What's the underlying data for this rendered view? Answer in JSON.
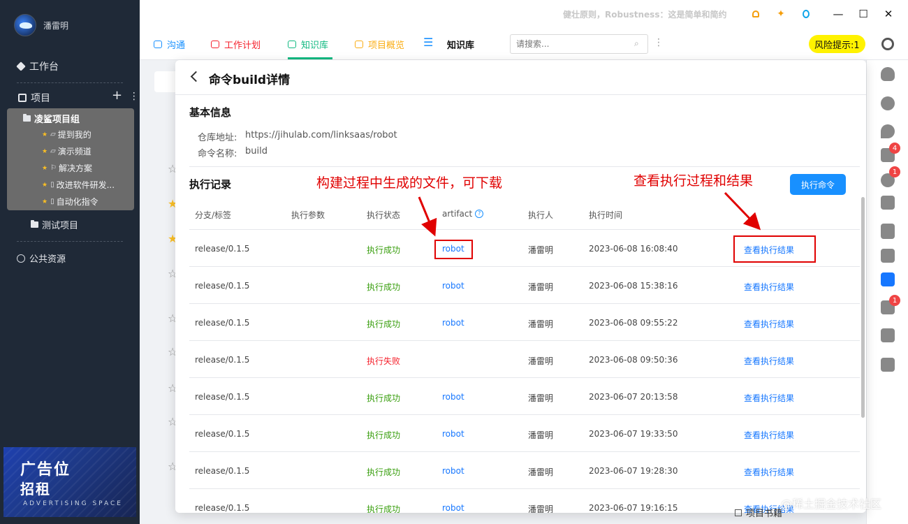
{
  "user": {
    "name": "潘雷明"
  },
  "sidebar": {
    "workbench": "工作台",
    "projects": "项目",
    "add": "+",
    "more": "⋮",
    "group": {
      "title": "凌鲨项目组",
      "items": [
        {
          "icon": "chat-icon",
          "label": "提到我的"
        },
        {
          "icon": "chat-icon",
          "label": "演示频道"
        },
        {
          "icon": "flag-icon",
          "label": "解决方案"
        },
        {
          "icon": "doc-icon",
          "label": "改进软件研发..."
        },
        {
          "icon": "doc-icon",
          "label": "自动化指令"
        }
      ]
    },
    "test_project": "测试项目",
    "public": "公共资源",
    "ad": {
      "line1": "广告位",
      "line2": "招租",
      "line3": "ADVERTISING SPACE"
    }
  },
  "topbar": {
    "tip": "健壮原则，Robustness：这是简单和简约"
  },
  "tabs": {
    "items": [
      {
        "label": "沟通",
        "color": "#1890ff"
      },
      {
        "label": "工作计划",
        "color": "#f5222d"
      },
      {
        "label": "知识库",
        "color": "#10b981"
      },
      {
        "label": "项目概览",
        "color": "#faad14"
      }
    ],
    "current": "知识库",
    "search_placeholder": "请搜索...",
    "risk": "风险提示:1"
  },
  "panel": {
    "title": "命令build详情",
    "basic_title": "基本信息",
    "repo_label": "仓库地址:",
    "repo_value": "https://jihulab.com/linksaas/robot",
    "cmd_label": "命令名称:",
    "cmd_value": "build",
    "exec_title": "执行记录",
    "exec_button": "执行命令",
    "columns": [
      "分支/标签",
      "执行参数",
      "执行状态",
      "artifact",
      "执行人",
      "执行时间"
    ],
    "rows": [
      {
        "branch": "release/0.1.5",
        "params": "",
        "status": "执行成功",
        "artifact": "robot",
        "user": "潘雷明",
        "time": "2023-06-08 16:08:40",
        "action": "查看执行结果"
      },
      {
        "branch": "release/0.1.5",
        "params": "",
        "status": "执行成功",
        "artifact": "robot",
        "user": "潘雷明",
        "time": "2023-06-08 15:38:16",
        "action": "查看执行结果"
      },
      {
        "branch": "release/0.1.5",
        "params": "",
        "status": "执行成功",
        "artifact": "robot",
        "user": "潘雷明",
        "time": "2023-06-08 09:55:22",
        "action": "查看执行结果"
      },
      {
        "branch": "release/0.1.5",
        "params": "",
        "status": "执行失败",
        "artifact": "",
        "user": "潘雷明",
        "time": "2023-06-08 09:50:36",
        "action": "查看执行结果"
      },
      {
        "branch": "release/0.1.5",
        "params": "",
        "status": "执行成功",
        "artifact": "robot",
        "user": "潘雷明",
        "time": "2023-06-07 20:13:58",
        "action": "查看执行结果"
      },
      {
        "branch": "release/0.1.5",
        "params": "",
        "status": "执行成功",
        "artifact": "robot",
        "user": "潘雷明",
        "time": "2023-06-07 19:33:50",
        "action": "查看执行结果"
      },
      {
        "branch": "release/0.1.5",
        "params": "",
        "status": "执行成功",
        "artifact": "robot",
        "user": "潘雷明",
        "time": "2023-06-07 19:28:30",
        "action": "查看执行结果"
      },
      {
        "branch": "release/0.1.5",
        "params": "",
        "status": "执行成功",
        "artifact": "robot",
        "user": "潘雷明",
        "time": "2023-06-07 19:16:15",
        "action": "查看执行结果"
      }
    ]
  },
  "annotations": {
    "artifact_note": "构建过程中生成的文件，可下载",
    "result_note": "查看执行过程和结果",
    "color": "#e00000"
  },
  "rightbar": {
    "badges": [
      "4",
      "1",
      "1"
    ]
  },
  "bottom": {
    "label": "项目书籍"
  },
  "watermark": "@稀土掘金技术社区"
}
